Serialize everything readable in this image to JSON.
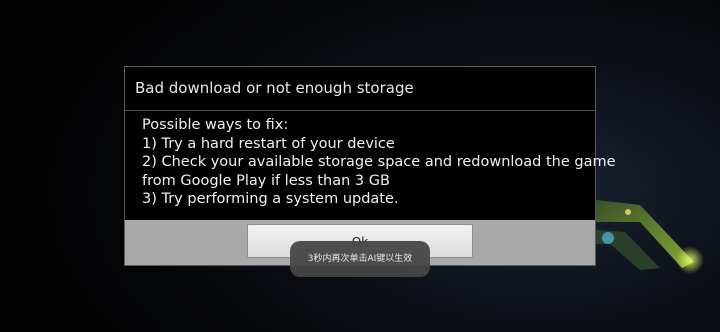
{
  "dialog": {
    "title": "Bad download or not enough storage",
    "lines": [
      "Possible ways to fix:",
      "1) Try a hard restart of your device",
      "2) Check your available storage space and redownload the game",
      "from Google Play if less than 3 GB",
      "3) Try performing a system update."
    ],
    "ok_label": "Ok"
  },
  "toast": {
    "text": "3秒内再次单击AI键以生效"
  },
  "colors": {
    "dialog_background": "#000000",
    "button_bar": "#a9a9a9",
    "toast_background": "#464646"
  }
}
